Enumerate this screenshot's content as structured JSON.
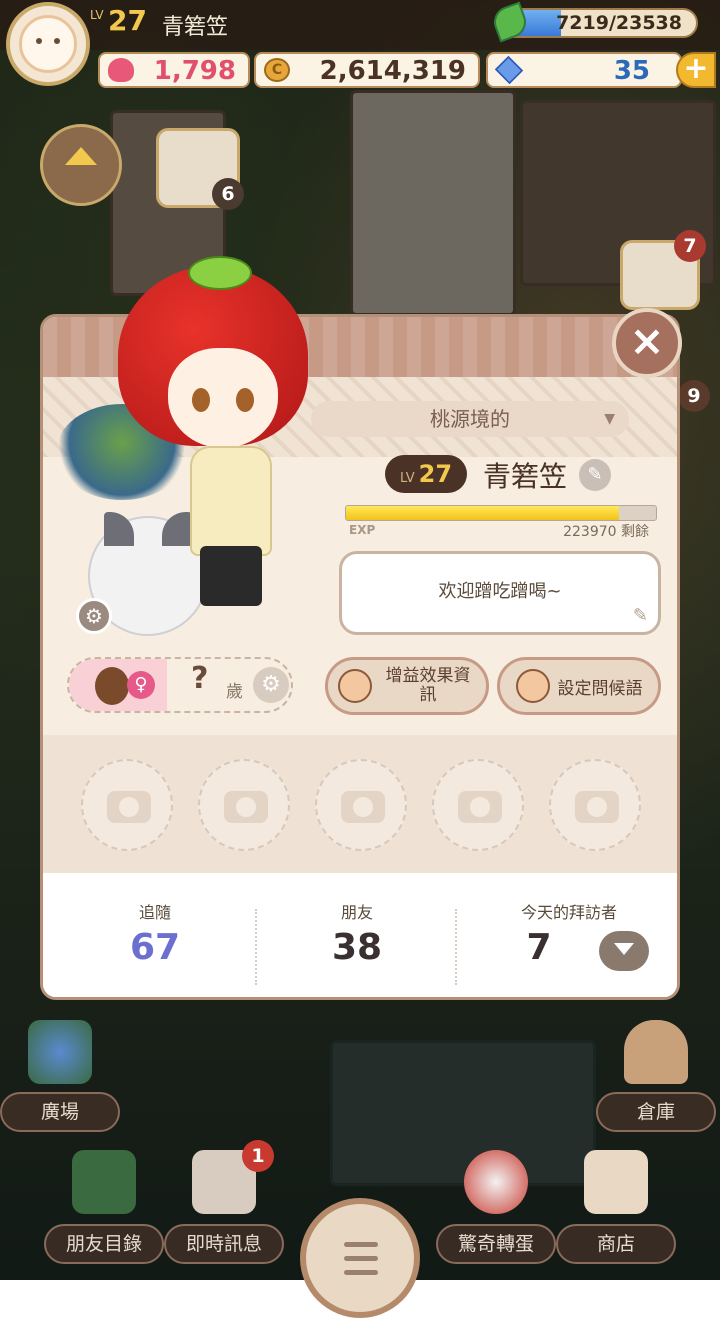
{
  "colors": {
    "accent": "#f2c94c",
    "dialog_bg": "#f7ede0",
    "follow_color": "#6b6fd0",
    "heart": "#e85878",
    "coin": "#e6a63a",
    "gem": "#6a9ae8"
  },
  "hud": {
    "lv_label": "LV",
    "level": "27",
    "player_name": "青箬笠",
    "exp_text": "7219/23538",
    "exp_fraction": 0.3067,
    "hearts": "1,798",
    "coins": "2,614,319",
    "coin_glyph": "C",
    "gems": "35",
    "plus": "+"
  },
  "side": {
    "badge_calendar": "6",
    "badge_right_top": "7",
    "badge_right_mid": "9"
  },
  "profile": {
    "title": "桃源境的",
    "lv_label": "LV",
    "level": "27",
    "name": "青箬笠",
    "exp_fraction": 0.88,
    "exp_label": "EXP",
    "exp_remaining": "223970 剩餘",
    "greeting": "欢迎蹭吃蹭喝~",
    "age_value": "?",
    "age_label": "歲",
    "buff_button": "增益效果資訊",
    "greeting_button": "設定問候語",
    "close": "×",
    "female_symbol": "♀",
    "icons": [
      "gear-icon",
      "pencil-icon",
      "camera-icon",
      "chevron-down-icon",
      "close-icon"
    ]
  },
  "stats": [
    {
      "label": "追隨",
      "value": "67"
    },
    {
      "label": "朋友",
      "value": "38"
    },
    {
      "label": "今天的拜訪者",
      "value": "7"
    }
  ],
  "bottom_nav": {
    "plaza": "廣場",
    "storage": "倉庫",
    "friends": "朋友目錄",
    "messages": "即時訊息",
    "messages_badge": "1",
    "gacha": "驚奇轉蛋",
    "shop": "商店"
  }
}
